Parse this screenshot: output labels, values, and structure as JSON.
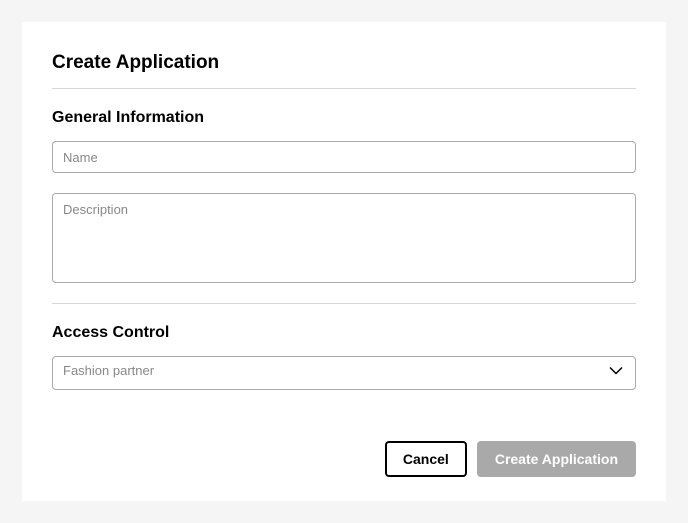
{
  "title": "Create Application",
  "sections": {
    "general": {
      "title": "General Information",
      "name_placeholder": "Name",
      "description_placeholder": "Description"
    },
    "access": {
      "title": "Access Control",
      "selected_option": "Fashion partner"
    }
  },
  "buttons": {
    "cancel": "Cancel",
    "submit": "Create Application"
  }
}
